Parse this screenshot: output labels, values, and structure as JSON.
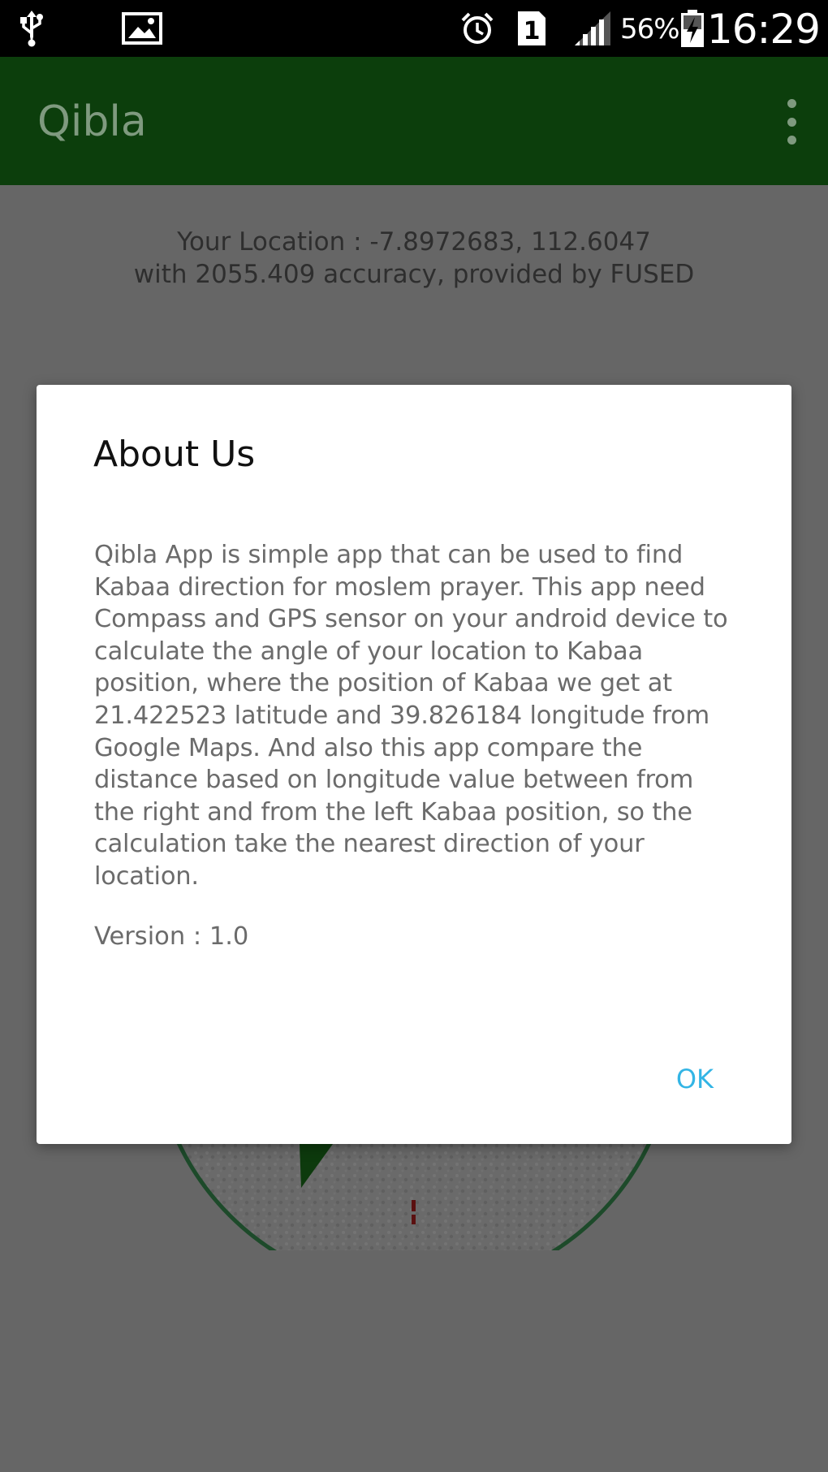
{
  "status_bar": {
    "time": "16:29",
    "battery_percent": "56%",
    "sim_slot": "1",
    "icons": [
      "usb-icon",
      "image-icon",
      "alarm-icon",
      "sim-icon",
      "signal-icon",
      "battery-charging-icon"
    ]
  },
  "app": {
    "title": "Qibla",
    "menu_icon": "overflow-menu-icon",
    "bar_color": "#0c3e0c"
  },
  "location": {
    "line1": "Your Location : -7.8972683, 112.6047",
    "line2": "with 2055.409 accuracy, provided by FUSED"
  },
  "dialog": {
    "title": "About Us",
    "body": "Qibla App is simple app that can be used to find Kabaa direction for moslem prayer. This app need Compass and GPS sensor on your android device to calculate the angle of your location to Kabaa position, where the position of Kabaa we get at 21.422523 latitude and 39.826184 longitude from Google Maps. And also this app compare the distance based on longitude value between from the right and from the left Kabaa position, so the calculation take the nearest direction of your location.",
    "version": "Version : 1.0",
    "ok_label": "OK",
    "accent_color": "#33b5e5"
  }
}
